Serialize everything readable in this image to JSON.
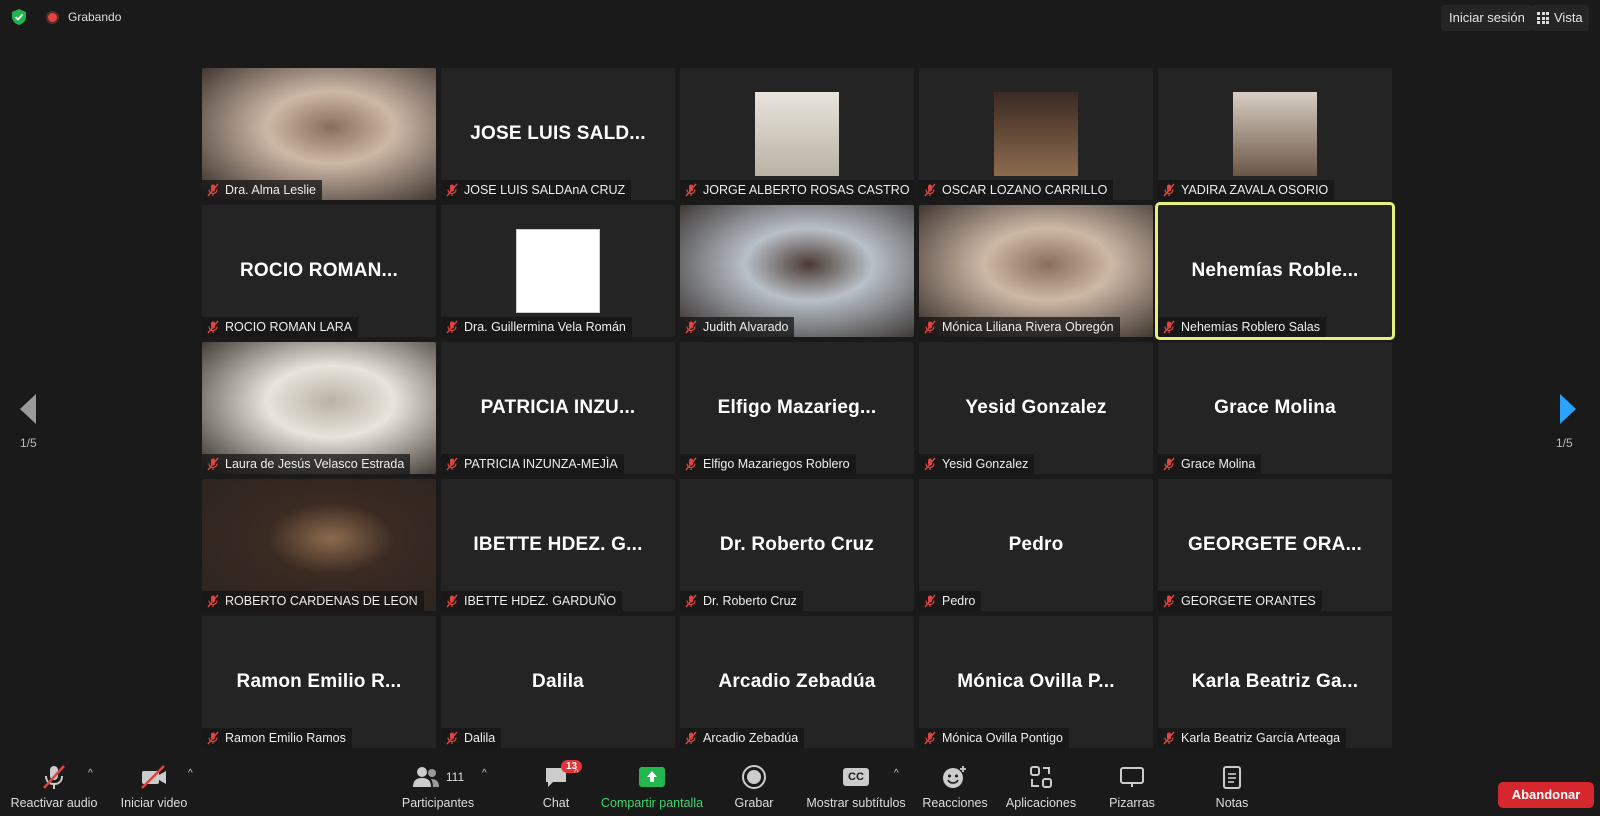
{
  "topbar": {
    "recording_label": "Grabando",
    "signin_label": "Iniciar sesión",
    "view_label": "Vista"
  },
  "pagination": {
    "left": "1/5",
    "right": "1/5"
  },
  "tiles": [
    {
      "display": "",
      "label": "Dra. Alma Leslie",
      "video": true
    },
    {
      "display": "JOSE LUIS SALD...",
      "label": "JOSE LUIS SALDAnA CRUZ",
      "video": false
    },
    {
      "display": "",
      "label": "JORGE ALBERTO ROSAS CASTRO",
      "video": true
    },
    {
      "display": "",
      "label": "OSCAR LOZANO CARRILLO",
      "video": true
    },
    {
      "display": "",
      "label": "YADIRA ZAVALA OSORIO",
      "video": true
    },
    {
      "display": "ROCIO ROMAN...",
      "label": "ROCIO ROMAN LARA",
      "video": false
    },
    {
      "display": "",
      "label": "Dra. Guillermina Vela Román",
      "video": true
    },
    {
      "display": "",
      "label": "Judith Alvarado",
      "video": true
    },
    {
      "display": "",
      "label": "Mónica Liliana Rivera Obregón",
      "video": true
    },
    {
      "display": "Nehemías Roble...",
      "label": "Nehemías Roblero Salas",
      "video": false
    },
    {
      "display": "",
      "label": "Laura de Jesús Velasco Estrada",
      "video": true
    },
    {
      "display": "PATRICIA INZU...",
      "label": "PATRICIA INZUNZA-MEJÌA",
      "video": false
    },
    {
      "display": "Elfigo Mazarieg...",
      "label": "Elfigo Mazariegos Roblero",
      "video": false
    },
    {
      "display": "Yesid Gonzalez",
      "label": "Yesid Gonzalez",
      "video": false
    },
    {
      "display": "Grace Molina",
      "label": "Grace Molina",
      "video": false
    },
    {
      "display": "",
      "label": "ROBERTO CARDENAS DE LEON",
      "video": true
    },
    {
      "display": "IBETTE HDEZ. G...",
      "label": "IBETTE HDEZ. GARDUÑO",
      "video": false
    },
    {
      "display": "Dr. Roberto Cruz",
      "label": "Dr. Roberto Cruz",
      "video": false
    },
    {
      "display": "Pedro",
      "label": "Pedro",
      "video": false
    },
    {
      "display": "GEORGETE ORA...",
      "label": "GEORGETE ORANTES",
      "video": false
    },
    {
      "display": "Ramon Emilio R...",
      "label": "Ramon Emilio Ramos",
      "video": false
    },
    {
      "display": "Dalila",
      "label": "Dalila",
      "video": false
    },
    {
      "display": "Arcadio Zebadúa",
      "label": "Arcadio Zebadúa",
      "video": false
    },
    {
      "display": "Mónica Ovilla P...",
      "label": "Mónica Ovilla Pontigo",
      "video": false
    },
    {
      "display": "Karla Beatriz Ga...",
      "label": "Karla Beatriz García Arteaga",
      "video": false
    }
  ],
  "toolbar": {
    "audio_label": "Reactivar audio",
    "video_label": "Iniciar video",
    "participants_label": "Participantes",
    "participants_count": "111",
    "chat_label": "Chat",
    "chat_badge": "13",
    "share_label": "Compartir pantalla",
    "record_label": "Grabar",
    "captions_label": "Mostrar subtítulos",
    "captions_icon_text": "CC",
    "reactions_label": "Reacciones",
    "apps_label": "Aplicaciones",
    "whiteboards_label": "Pizarras",
    "notes_label": "Notas",
    "leave_label": "Abandonar"
  },
  "colors": {
    "active_speaker_border": "#e5f17a",
    "leave_button": "#d6262e",
    "share_green": "#22b84f",
    "nav_arrow_blue": "#2aa3ff",
    "mute_red": "#e0443e"
  }
}
